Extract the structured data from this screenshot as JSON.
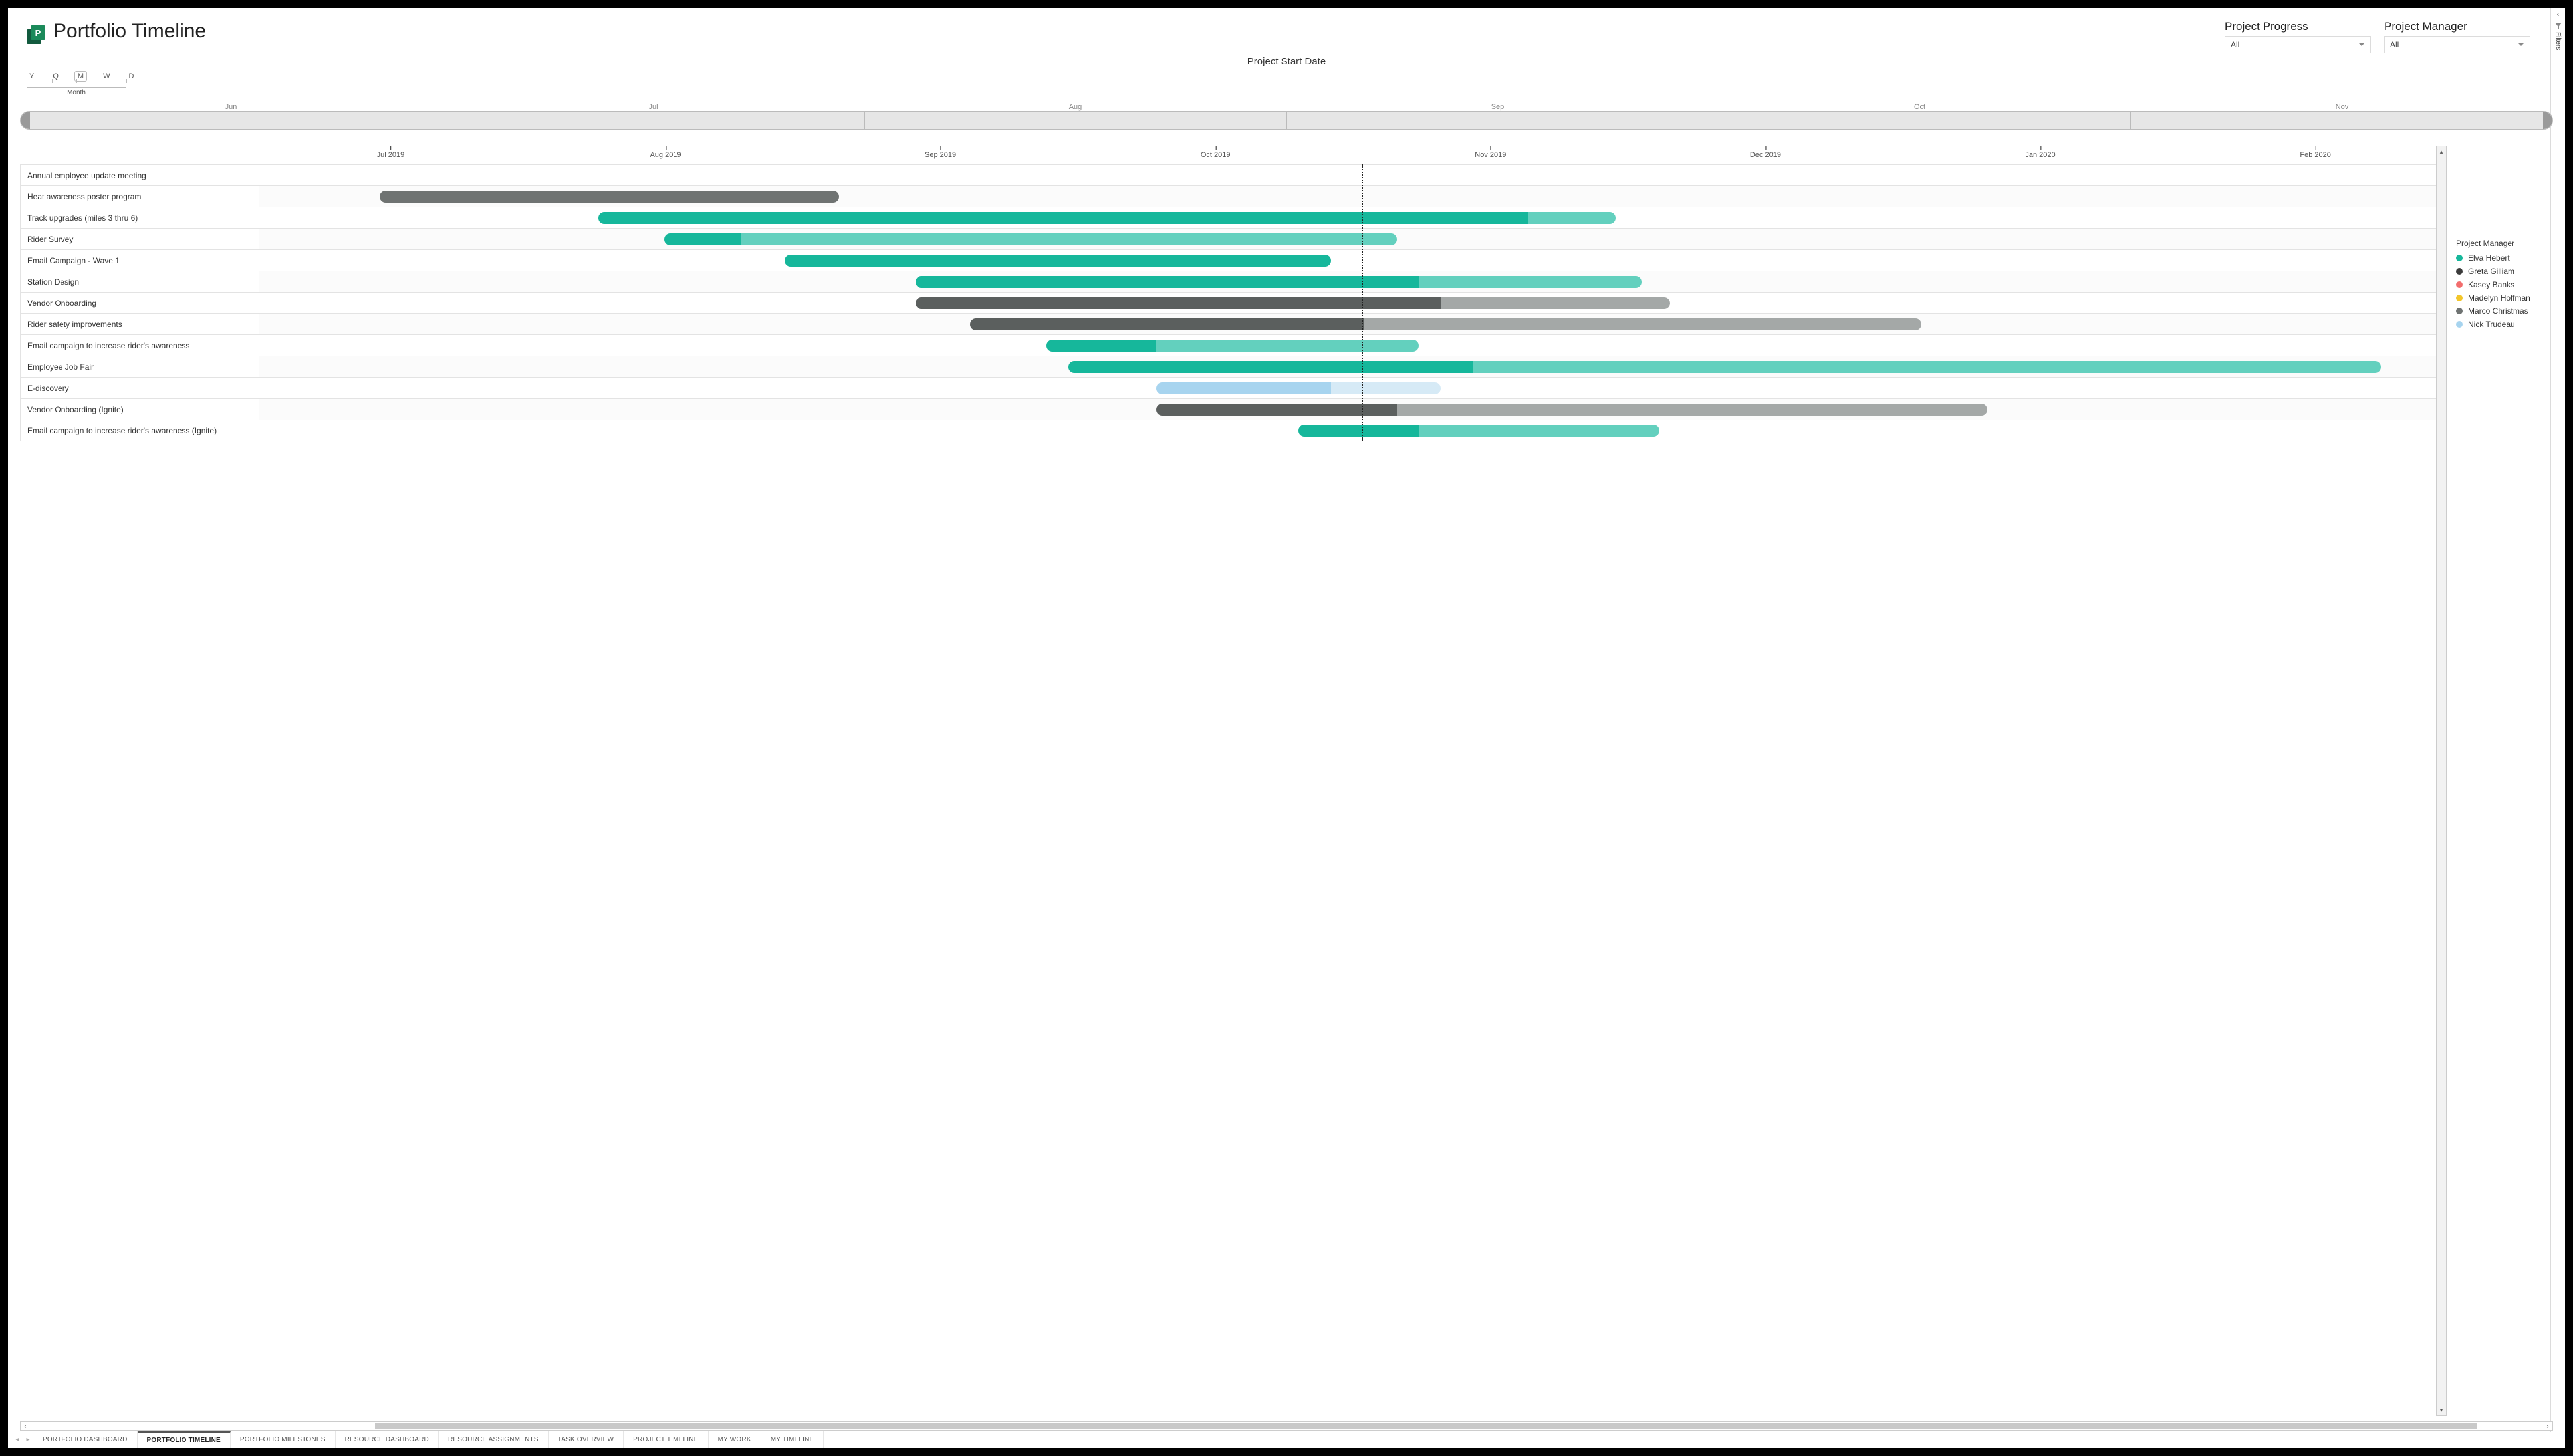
{
  "header": {
    "title": "Portfolio Timeline",
    "logo_letter": "P",
    "subtitle": "Project Start Date"
  },
  "filters": {
    "progress_label": "Project Progress",
    "progress_value": "All",
    "manager_label": "Project Manager",
    "manager_value": "All",
    "rail_label": "Filters"
  },
  "granularity": {
    "options": [
      "Y",
      "Q",
      "M",
      "W",
      "D"
    ],
    "selected": "M",
    "caption": "Month"
  },
  "overview": {
    "months": [
      "Jun",
      "Jul",
      "Aug",
      "Sep",
      "Oct",
      "Nov"
    ]
  },
  "axis_ticks": [
    "Jul 2019",
    "Aug 2019",
    "Sep 2019",
    "Oct 2019",
    "Nov 2019",
    "Dec 2019",
    "Jan 2020",
    "Feb 2020"
  ],
  "legend": {
    "title": "Project Manager",
    "items": [
      {
        "name": "Elva Hebert",
        "color": "#16b79b"
      },
      {
        "name": "Greta Gilliam",
        "color": "#3b3b3b"
      },
      {
        "name": "Kasey Banks",
        "color": "#f26d6d"
      },
      {
        "name": "Madelyn Hoffman",
        "color": "#f3c62a"
      },
      {
        "name": "Marco Christmas",
        "color": "#6f7372"
      },
      {
        "name": "Nick Trudeau",
        "color": "#a7d4ef"
      }
    ]
  },
  "tabs": [
    "PORTFOLIO DASHBOARD",
    "PORTFOLIO TIMELINE",
    "PORTFOLIO MILESTONES",
    "RESOURCE DASHBOARD",
    "RESOURCE ASSIGNMENTS",
    "TASK OVERVIEW",
    "PROJECT TIMELINE",
    "MY WORK",
    "MY TIMELINE"
  ],
  "active_tab": 1,
  "chart_data": {
    "type": "gantt",
    "title": "Project Start Date",
    "today_frac": 0.504,
    "domain": {
      "start": "2019-06-22",
      "end": "2020-02-28",
      "label_ticks": [
        "Jul 2019",
        "Aug 2019",
        "Sep 2019",
        "Oct 2019",
        "Nov 2019",
        "Dec 2019",
        "Jan 2020",
        "Feb 2020"
      ]
    },
    "rows": [
      {
        "name": "Annual employee update meeting",
        "segments": []
      },
      {
        "name": "Heat awareness poster program",
        "segments": [
          {
            "start": 0.055,
            "end": 0.265,
            "color": "#6f7372"
          }
        ]
      },
      {
        "name": "Track upgrades (miles 3 thru 6)",
        "segments": [
          {
            "start": 0.155,
            "end": 0.58,
            "color": "#16b79b"
          },
          {
            "start": 0.58,
            "end": 0.62,
            "color": "#63d0be"
          }
        ]
      },
      {
        "name": "Rider Survey",
        "segments": [
          {
            "start": 0.185,
            "end": 0.22,
            "color": "#16b79b"
          },
          {
            "start": 0.22,
            "end": 0.52,
            "color": "#63d0be"
          }
        ]
      },
      {
        "name": "Email Campaign - Wave 1",
        "segments": [
          {
            "start": 0.24,
            "end": 0.49,
            "color": "#16b79b"
          }
        ]
      },
      {
        "name": "Station Design",
        "segments": [
          {
            "start": 0.3,
            "end": 0.53,
            "color": "#16b79b"
          },
          {
            "start": 0.53,
            "end": 0.632,
            "color": "#63d0be"
          }
        ]
      },
      {
        "name": "Vendor Onboarding",
        "segments": [
          {
            "start": 0.3,
            "end": 0.54,
            "color": "#5b5f5e"
          },
          {
            "start": 0.54,
            "end": 0.645,
            "color": "#a4a8a7"
          }
        ]
      },
      {
        "name": "Rider safety improvements",
        "segments": [
          {
            "start": 0.325,
            "end": 0.505,
            "color": "#5b5f5e"
          },
          {
            "start": 0.505,
            "end": 0.76,
            "color": "#a4a8a7"
          }
        ]
      },
      {
        "name": "Email campaign to increase rider's awareness",
        "segments": [
          {
            "start": 0.36,
            "end": 0.41,
            "color": "#16b79b"
          },
          {
            "start": 0.41,
            "end": 0.53,
            "color": "#63d0be"
          }
        ]
      },
      {
        "name": "Employee Job Fair",
        "segments": [
          {
            "start": 0.37,
            "end": 0.555,
            "color": "#16b79b"
          },
          {
            "start": 0.555,
            "end": 0.97,
            "color": "#63d0be"
          }
        ]
      },
      {
        "name": "E-discovery",
        "segments": [
          {
            "start": 0.41,
            "end": 0.49,
            "color": "#a7d4ef"
          },
          {
            "start": 0.49,
            "end": 0.54,
            "color": "#d6eaf6"
          }
        ]
      },
      {
        "name": "Vendor Onboarding (Ignite)",
        "segments": [
          {
            "start": 0.41,
            "end": 0.52,
            "color": "#5b5f5e"
          },
          {
            "start": 0.52,
            "end": 0.79,
            "color": "#a4a8a7"
          }
        ]
      },
      {
        "name": "Email campaign to increase rider's awareness (Ignite)",
        "segments": [
          {
            "start": 0.475,
            "end": 0.53,
            "color": "#16b79b"
          },
          {
            "start": 0.53,
            "end": 0.64,
            "color": "#63d0be"
          }
        ]
      }
    ]
  }
}
